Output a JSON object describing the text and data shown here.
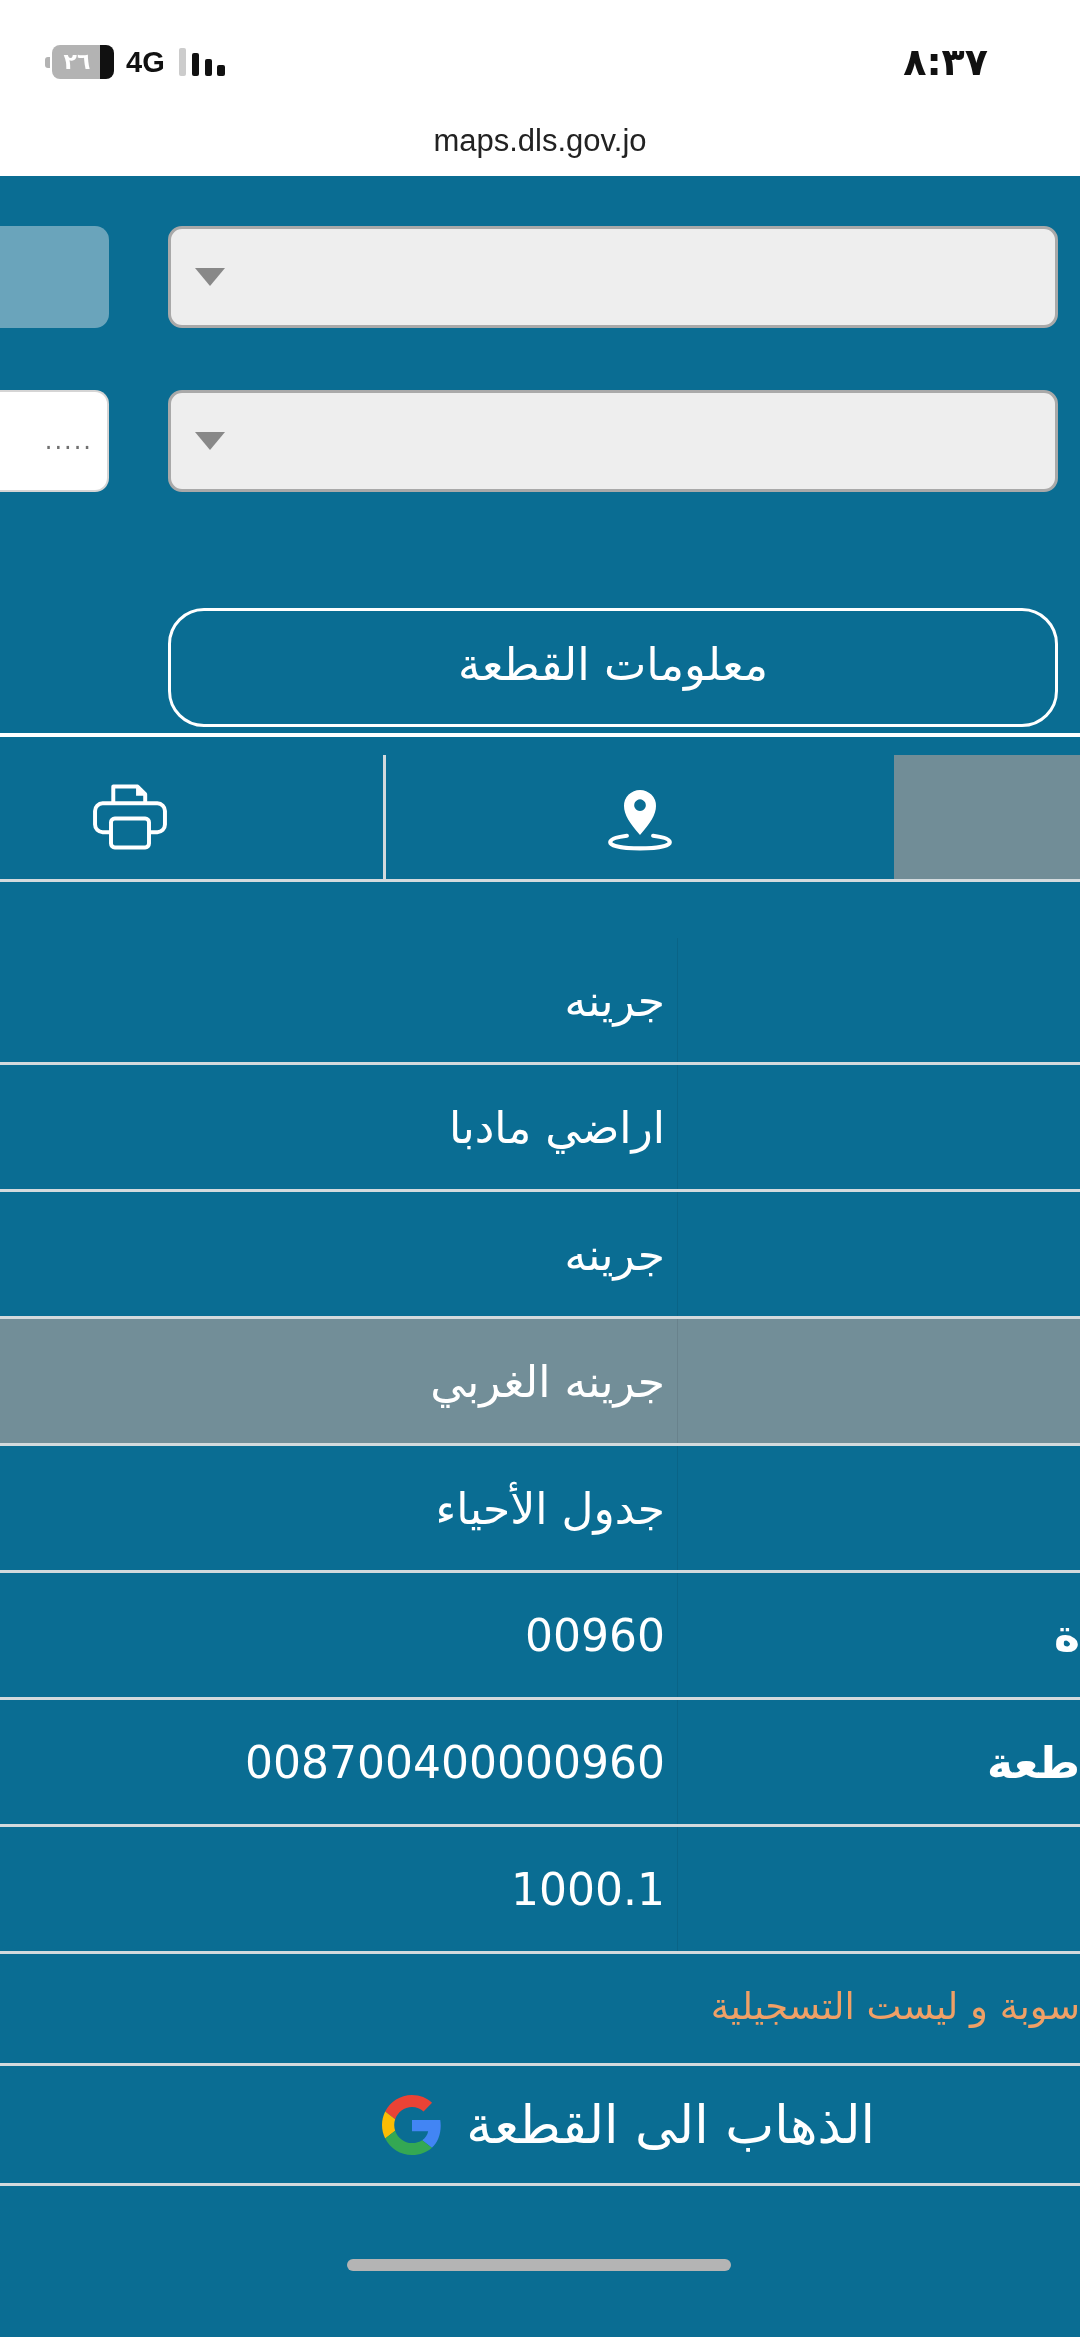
{
  "status_bar": {
    "time": "٨:٣٧",
    "network": "4G",
    "battery": "٢٦"
  },
  "address_bar": {
    "url": "maps.dls.gov.jo"
  },
  "form": {
    "rows": [
      {
        "controls": [
          {
            "kind": "dropdown"
          },
          {
            "kind": "button"
          }
        ]
      },
      {
        "controls": [
          {
            "kind": "dropdown"
          },
          {
            "kind": "input",
            "placeholder": "....."
          }
        ]
      }
    ],
    "info_button": {
      "label": "معلومات القطعة"
    }
  },
  "tabs": [
    {
      "kind": "print",
      "selected": false
    },
    {
      "kind": "location",
      "selected": false
    },
    {
      "kind": "blank",
      "selected": true
    }
  ],
  "details": {
    "rows": [
      {
        "value": "جرينه",
        "selected": false
      },
      {
        "value": "اراضي مادبا",
        "selected": false
      },
      {
        "value": "جرينه",
        "selected": false
      },
      {
        "value": "جرينه الغربي",
        "selected": true
      },
      {
        "value": "جدول الأحياء",
        "selected": false
      },
      {
        "label": "ة",
        "value": "00960",
        "selected": false
      },
      {
        "label": "طعة",
        "value": "008700400000960",
        "selected": false
      },
      {
        "value": "1000.1",
        "selected": false
      }
    ],
    "note": "سوبة و ليست التسجيلية",
    "goto_button": {
      "label": "الذهاب الى القطعة"
    }
  }
}
